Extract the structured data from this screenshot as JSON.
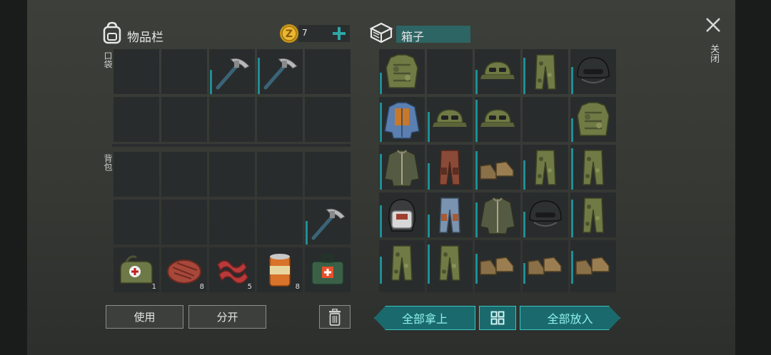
{
  "inventory": {
    "title": "物品栏",
    "coins": "7",
    "add_icon": "plus-icon",
    "pocket_label": "口袋",
    "backpack_label": "背包",
    "pocket_slots": [
      "empty",
      "empty",
      "pickaxe",
      "pickaxe",
      "empty",
      "empty",
      "empty",
      "empty",
      "empty",
      "empty"
    ],
    "backpack_slots": [
      {
        "item": "empty"
      },
      {
        "item": "empty"
      },
      {
        "item": "empty"
      },
      {
        "item": "empty"
      },
      {
        "item": "empty"
      },
      {
        "item": "empty"
      },
      {
        "item": "empty"
      },
      {
        "item": "empty"
      },
      {
        "item": "empty"
      },
      {
        "item": "pickaxe"
      },
      {
        "item": "first-aid-bag",
        "qty": "1"
      },
      {
        "item": "steak",
        "qty": "8"
      },
      {
        "item": "bacon",
        "qty": "5"
      },
      {
        "item": "canned-food",
        "qty": "8"
      },
      {
        "item": "medkit",
        "qty": ""
      }
    ]
  },
  "box": {
    "title": "箱子",
    "slots": [
      "camo-vest",
      "empty",
      "camo-cap",
      "camo-pants",
      "combat-helmet",
      "blue-armor-jacket",
      "camo-cap",
      "camo-cap",
      "empty",
      "camo-vest",
      "green-jacket",
      "brown-pants",
      "boots",
      "camo-pants",
      "camo-pants",
      "biker-helmet",
      "blue-pants",
      "green-jacket",
      "combat-helmet",
      "camo-pants",
      "camo-pants",
      "camo-pants",
      "boots",
      "boots",
      "boots"
    ]
  },
  "actions": {
    "use": "使用",
    "split": "分开",
    "take_all": "全部拿上",
    "put_all": "全部放入"
  },
  "close": {
    "label": "关闭"
  },
  "colors": {
    "accent": "#1a6a6d",
    "accent_text": "#8ff0ea",
    "durability": "#1e8f96"
  }
}
